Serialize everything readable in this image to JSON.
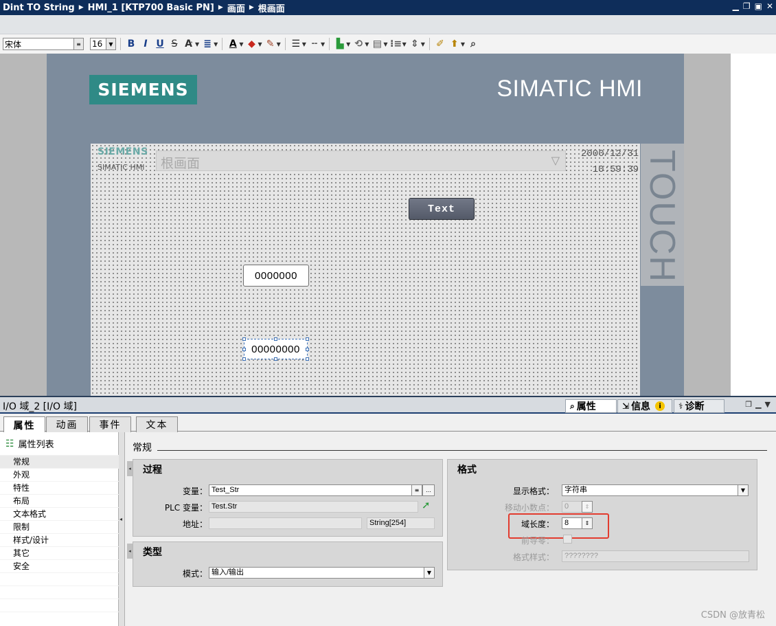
{
  "titlebar": {
    "crumbs": [
      "Dint TO String",
      "HMI_1 [KTP700 Basic PN]",
      "画面",
      "根画面"
    ]
  },
  "toolbar": {
    "font_family": "宋体",
    "font_size": "16",
    "bold_label": "B",
    "italic_label": "I",
    "underline_label": "U",
    "strike_label": "S",
    "grow_label": "A"
  },
  "device": {
    "brand_logo": "SIEMENS",
    "model_label": "SIMATIC HMI",
    "side_label": "TOUCH"
  },
  "screen": {
    "logo_brand": "SIEMENS",
    "logo_sub": "SIMATIC HMI",
    "screen_name": "根画面",
    "date": "2000/12/31",
    "time": "10:59:39",
    "text_button": "Text",
    "io_field_1": "0000000",
    "io_field_2": "00000000"
  },
  "inspector": {
    "title": "I/O 域_2 [I/O 域]",
    "tabs": {
      "properties": "属性",
      "info": "信息",
      "diagnostics": "诊断"
    },
    "subtabs": [
      "属性",
      "动画",
      "事件",
      "文本"
    ],
    "nav_header": "属性列表",
    "nav_items": [
      "常规",
      "外观",
      "特性",
      "布局",
      "文本格式",
      "限制",
      "样式/设计",
      "其它",
      "安全"
    ],
    "section_title": "常规",
    "process": {
      "title": "过程",
      "variable_label": "变量：",
      "variable_value": "Test_Str",
      "plc_variable_label": "PLC 变量：",
      "plc_variable_value": "Test.Str",
      "address_label": "地址：",
      "address_value": "",
      "datatype_value": "String[254]"
    },
    "type": {
      "title": "类型",
      "mode_label": "模式：",
      "mode_value": "输入/输出"
    },
    "format": {
      "title": "格式",
      "display_format_label": "显示格式：",
      "display_format_value": "字符串",
      "decimal_shift_label": "移动小数点：",
      "decimal_shift_value": "0",
      "field_length_label": "域长度：",
      "field_length_value": "8",
      "leading_zeros_label": "前导零：",
      "format_pattern_label": "格式样式：",
      "format_pattern_value": "????????"
    }
  },
  "watermark": "CSDN @放青松",
  "colors": {
    "title_bar": "#0e2d5a",
    "device_frame": "#7d8c9d",
    "siemens_teal": "#2f8a86",
    "highlight_red": "#e23b2e"
  }
}
